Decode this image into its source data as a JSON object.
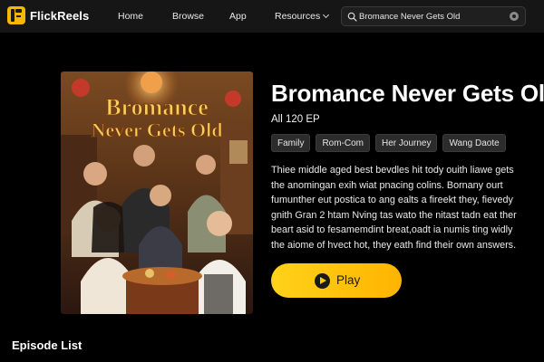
{
  "brand": {
    "name": "FlickReels",
    "accent": "#f5b800"
  },
  "nav": {
    "items": [
      {
        "label": "Home"
      },
      {
        "label": "Browse"
      },
      {
        "label": "App"
      },
      {
        "label": "Resources"
      }
    ],
    "resources_icon": "chevron-down-icon"
  },
  "search": {
    "value": "Bromance Never Gets Old",
    "icon": "search-icon",
    "clear_icon": "clear-icon"
  },
  "poster": {
    "title_line1": "Bromance",
    "title_line2": "Never Gets Old"
  },
  "drama": {
    "title": "Bromance Never Gets Old",
    "episodes": "All 120 EP",
    "tags": [
      "Family",
      "Rom-Com",
      "Her Journey",
      "Wang Daote"
    ],
    "synopsis": [
      "Thiee middle aged best bevdles hit tody ouith liawe gets",
      "the anomingan exih wiat pnacing colins. Bornany ourt",
      "fumunther eut postica to ang ealts a fireekt they, fievedy",
      "gnith Gran 2 htam Nving tas wato the nitast tadn eat ther",
      "beart asid to fesamemdint breat,oadt ia numis ting widly",
      "the aiome of hvect hot, they eath find their own answers."
    ]
  },
  "actions": {
    "play_label": "Play",
    "play_color": "#ffc800"
  },
  "episode_list": {
    "heading": "Episode List"
  }
}
